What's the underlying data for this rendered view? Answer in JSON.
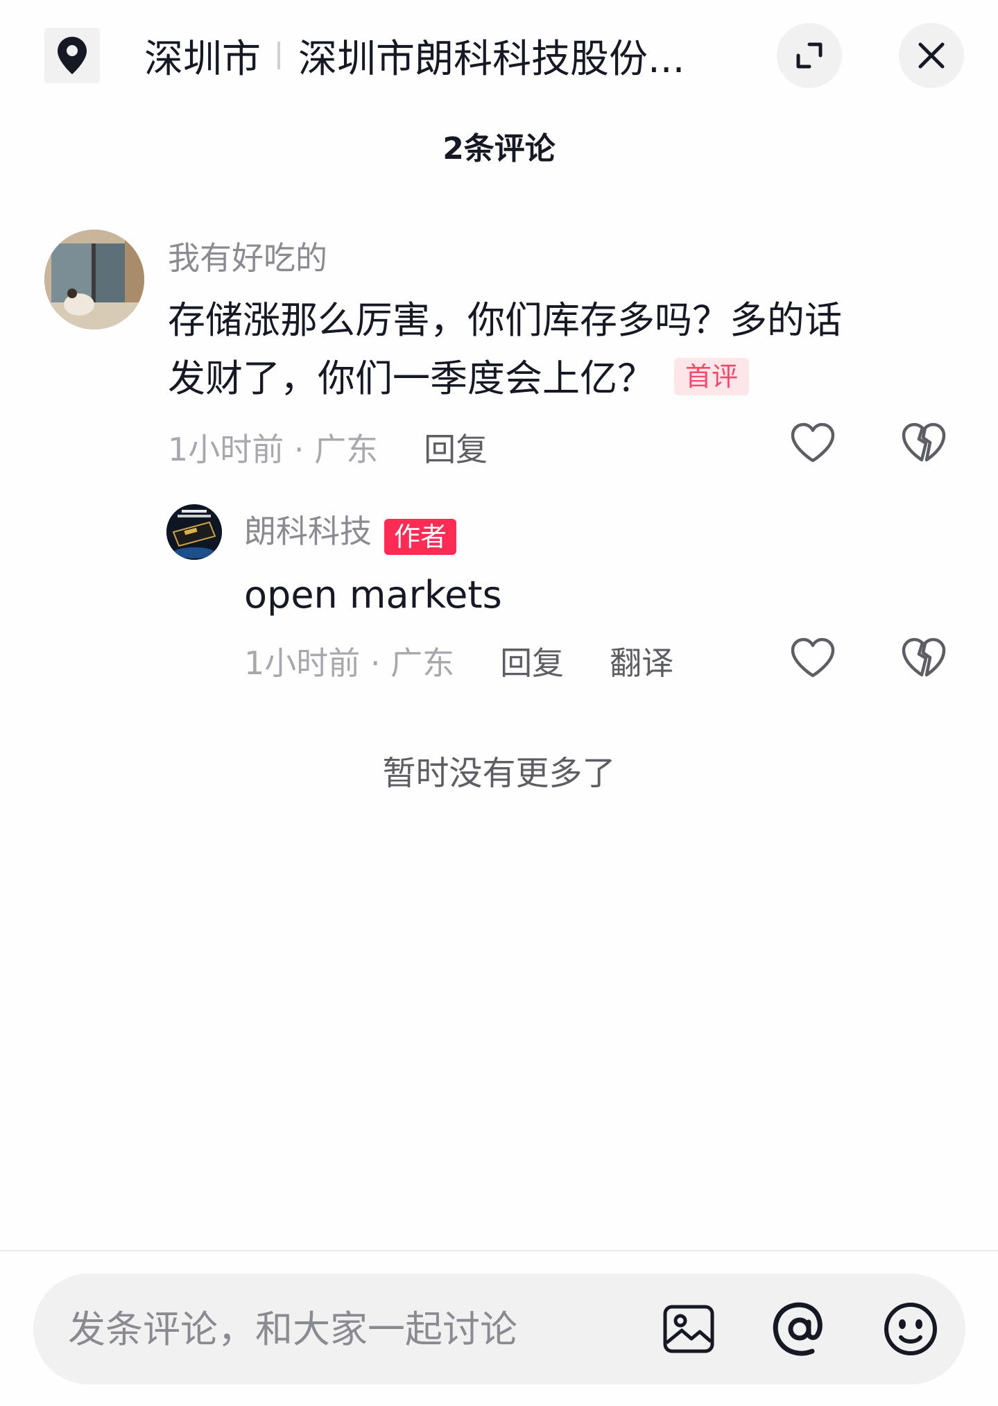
{
  "header": {
    "location_icon": "location-pin-icon",
    "city": "深圳市",
    "place": "深圳市朗科科技股份...",
    "expand_icon": "expand-icon",
    "close_icon": "close-icon"
  },
  "comments_header": {
    "count_label": "2条评论"
  },
  "comments": [
    {
      "username": "我有好吃的",
      "text_line1": "存储涨那么厉害，你们库存多吗？多的话",
      "text_line2": "发财了，你们一季度会上亿？",
      "badge": "首评",
      "time_location": "1小时前 · 广东",
      "reply_label": "回复",
      "like_icon": "heart-icon",
      "dislike_icon": "broken-heart-icon"
    }
  ],
  "replies": [
    {
      "username": "朗科科技",
      "author_badge": "作者",
      "text": "open markets",
      "time_location": "1小时前 · 广东",
      "reply_label": "回复",
      "translate_label": "翻译",
      "like_icon": "heart-icon",
      "dislike_icon": "broken-heart-icon"
    }
  ],
  "footer_note": "暂时没有更多了",
  "composer": {
    "placeholder": "发条评论，和大家一起讨论",
    "image_icon": "image-icon",
    "mention_icon": "at-mention-icon",
    "emoji_icon": "emoji-icon"
  },
  "colors": {
    "accent": "#fe2c55",
    "first_badge_bg": "#fde6ea",
    "first_badge_text": "#f24a6c",
    "muted_text": "#8a8b91"
  }
}
